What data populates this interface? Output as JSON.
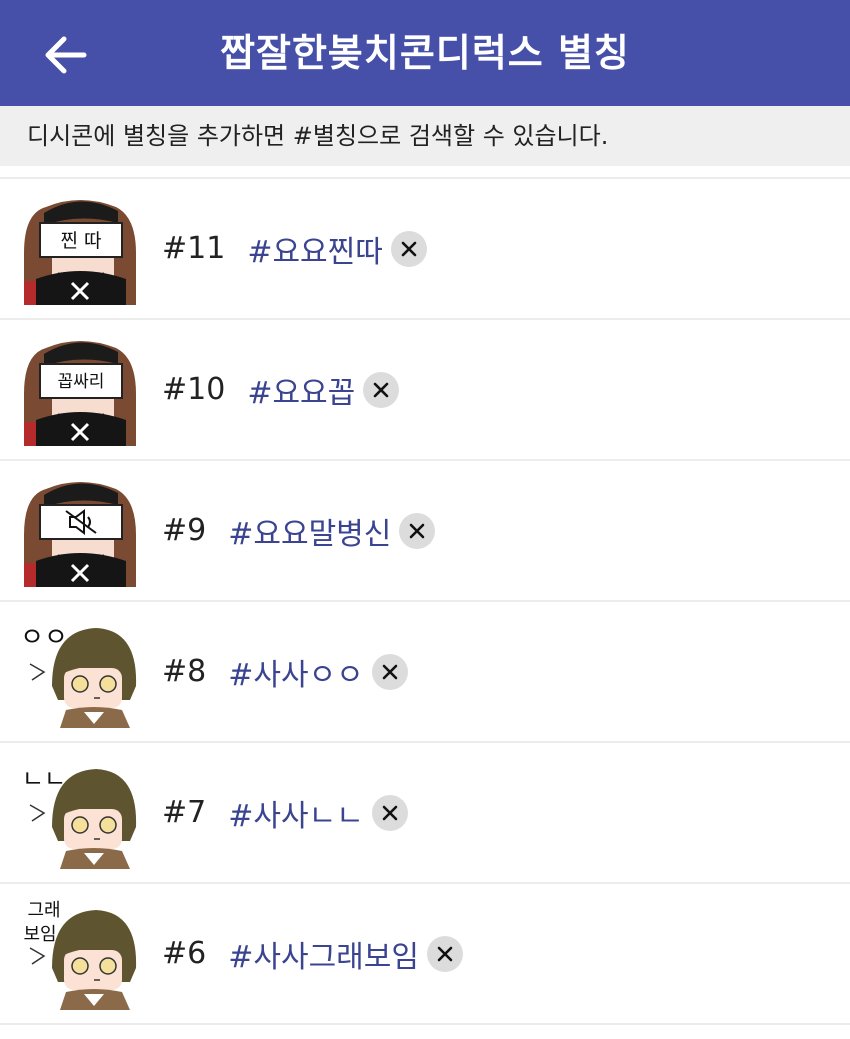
{
  "theme": {
    "brand": "#4750a8",
    "tag_color": "#3a4490",
    "delete_bg": "#dcdcdc"
  },
  "header": {
    "back_icon": "arrow-left-icon",
    "title": "짭잘한봊치콘디럭스 별칭"
  },
  "info": {
    "text": "디시콘에 별칭을 추가하면 #별칭으로 검색할 수 있습니다."
  },
  "aliases": [
    {
      "number": "#11",
      "tag": "#요요찐따",
      "sticker_text": "찐 따",
      "delete_icon": "close-icon"
    },
    {
      "number": "#10",
      "tag": "#요요꼽",
      "sticker_text": "꼽싸리",
      "delete_icon": "close-icon"
    },
    {
      "number": "#9",
      "tag": "#요요말병신",
      "sticker_text": "",
      "delete_icon": "close-icon"
    },
    {
      "number": "#8",
      "tag": "#사사ㅇㅇ",
      "sticker_text": "ㅇㅇ",
      "delete_icon": "close-icon"
    },
    {
      "number": "#7",
      "tag": "#사사ㄴㄴ",
      "sticker_text": "ㄴㄴ",
      "delete_icon": "close-icon"
    },
    {
      "number": "#6",
      "tag": "#사사그래보임",
      "sticker_text": "그래\n보임",
      "delete_icon": "close-icon"
    }
  ]
}
